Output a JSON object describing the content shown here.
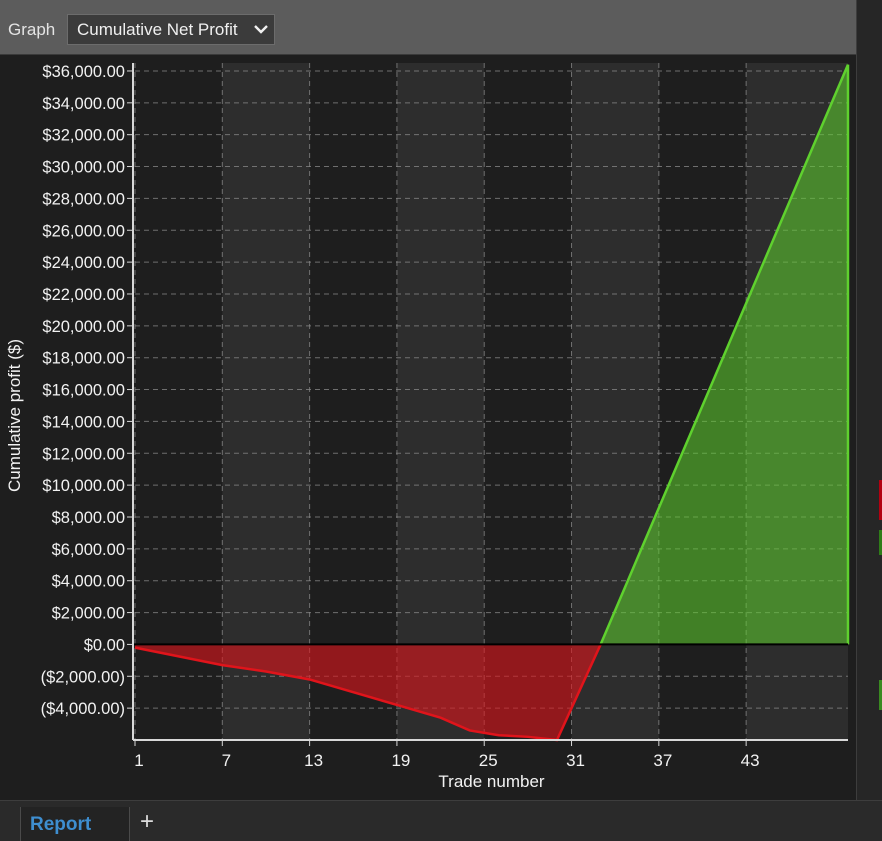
{
  "toolbar": {
    "graph_label": "Graph",
    "selected_graph": "Cumulative Net Profit"
  },
  "tabs": {
    "report_label": "Report",
    "add_label": "+"
  },
  "colors": {
    "positive": "#5fd12e",
    "negative": "#e0141b",
    "band": "#2d2d2d",
    "background": "#1e1e1e"
  },
  "chart_data": {
    "type": "area",
    "xlabel": "Trade number",
    "ylabel": "Cumulative profit ($)",
    "xlim": [
      1,
      50
    ],
    "ylim": [
      -6000,
      36500
    ],
    "xticks": [
      1,
      7,
      13,
      19,
      25,
      31,
      37,
      43
    ],
    "yticks": [
      {
        "value": 36000,
        "label": "$36,000.00"
      },
      {
        "value": 34000,
        "label": "$34,000.00"
      },
      {
        "value": 32000,
        "label": "$32,000.00"
      },
      {
        "value": 30000,
        "label": "$30,000.00"
      },
      {
        "value": 28000,
        "label": "$28,000.00"
      },
      {
        "value": 26000,
        "label": "$26,000.00"
      },
      {
        "value": 24000,
        "label": "$24,000.00"
      },
      {
        "value": 22000,
        "label": "$22,000.00"
      },
      {
        "value": 20000,
        "label": "$20,000.00"
      },
      {
        "value": 18000,
        "label": "$18,000.00"
      },
      {
        "value": 16000,
        "label": "$16,000.00"
      },
      {
        "value": 14000,
        "label": "$14,000.00"
      },
      {
        "value": 12000,
        "label": "$12,000.00"
      },
      {
        "value": 10000,
        "label": "$10,000.00"
      },
      {
        "value": 8000,
        "label": "$8,000.00"
      },
      {
        "value": 6000,
        "label": "$6,000.00"
      },
      {
        "value": 4000,
        "label": "$4,000.00"
      },
      {
        "value": 2000,
        "label": "$2,000.00"
      },
      {
        "value": 0,
        "label": "$0.00"
      },
      {
        "value": -2000,
        "label": "($2,000.00)"
      },
      {
        "value": -4000,
        "label": "($4,000.00)"
      }
    ],
    "x": [
      1,
      7,
      10,
      13,
      16,
      19,
      22,
      24,
      26,
      28,
      30,
      33,
      50
    ],
    "y": [
      -200,
      -1300,
      -1700,
      -2200,
      -3000,
      -3800,
      -4600,
      -5400,
      -5700,
      -5800,
      -6000,
      0,
      36400
    ],
    "grid": true
  }
}
